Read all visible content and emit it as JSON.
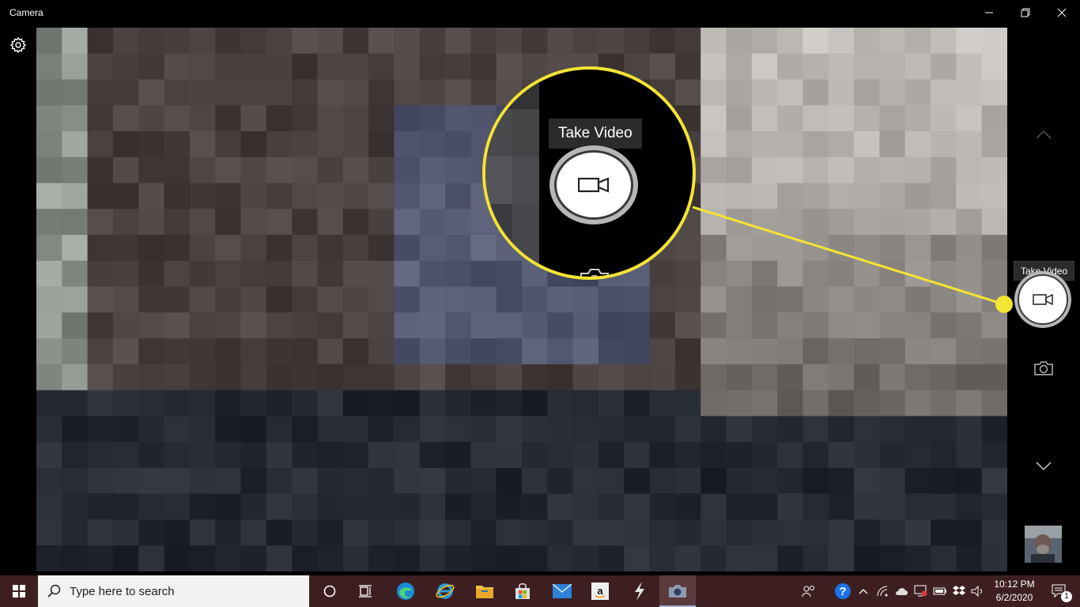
{
  "window": {
    "title": "Camera",
    "controls": [
      "minimize",
      "maximize",
      "close"
    ]
  },
  "camera": {
    "settings_icon": "gear-icon",
    "chevron_up_icon": "chevron-up-icon",
    "chevron_down_icon": "chevron-down-icon",
    "take_video_tooltip": "Take Video",
    "video_icon": "video-camera-icon",
    "photo_icon": "camera-icon"
  },
  "callout": {
    "tooltip": "Take Video",
    "accent_color": "#f4e434"
  },
  "taskbar": {
    "search_placeholder": "Type here to search",
    "pinned_apps": [
      "cortana",
      "task-view",
      "edge",
      "internet-explorer",
      "file-explorer",
      "microsoft-store",
      "mail",
      "amazon",
      "bolt-app",
      "camera"
    ],
    "time": "10:12 PM",
    "date": "6/2/2020",
    "notification_count": "1",
    "background_color": "#3d1f22"
  }
}
